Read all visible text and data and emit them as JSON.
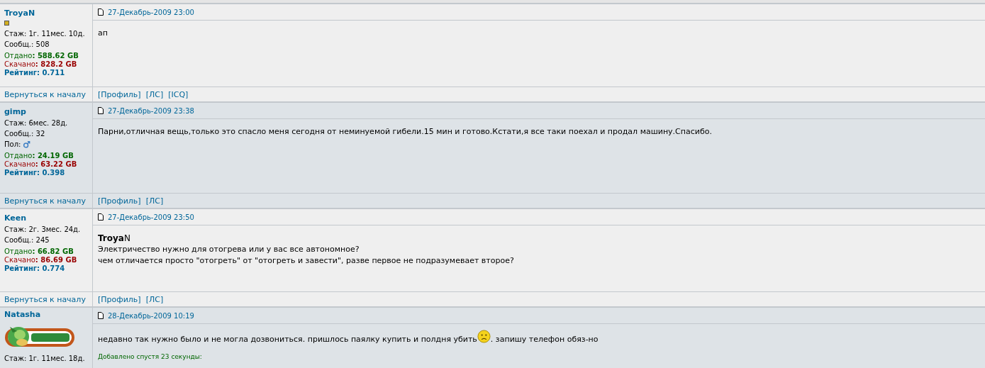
{
  "posts": [
    {
      "author": "**Troya**N",
      "rank_icon": true,
      "stats": [
        {
          "kind": "plain",
          "text": "Стаж: 1г. 11мес. 10д."
        },
        {
          "kind": "plain",
          "text": "Сообщ.: 508"
        },
        {
          "kind": "upload",
          "text": "Отдано**: 588.62 GB**"
        },
        {
          "kind": "download",
          "text": "Скачано**: 828.2 GB**"
        },
        {
          "kind": "rating",
          "text": "Рейтинг: 0.711"
        }
      ],
      "date": "27-Декабрь-2009 23:00",
      "body": [
        {
          "kind": "text",
          "text": "ап"
        }
      ],
      "back_link": "Вернуться к началу",
      "links": [
        "[Профиль]",
        "[ЛС]",
        "[ICQ]"
      ]
    },
    {
      "author": "gimp",
      "stats": [
        {
          "kind": "plain",
          "text": "Стаж: 6мес. 28д."
        },
        {
          "kind": "plain",
          "text": "Сообщ.: 32"
        },
        {
          "kind": "gender",
          "text": "Пол:"
        },
        {
          "kind": "upload",
          "text": "Отдано**: 24.19 GB**"
        },
        {
          "kind": "download",
          "text": "Скачано**: 63.22 GB**"
        },
        {
          "kind": "rating",
          "text": "Рейтинг: 0.398"
        }
      ],
      "date": "27-Декабрь-2009 23:38",
      "body": [
        {
          "kind": "text",
          "text": "Парни,отличная вещь,только это спасло меня сегодня от неминуемой гибели.15 мин и готово.Кстати,я все таки поехал и продал машину.Спасибо."
        }
      ],
      "back_link": "Вернуться к началу",
      "links": [
        "[Профиль]",
        "[ЛС]"
      ]
    },
    {
      "author": "Keen",
      "stats": [
        {
          "kind": "plain",
          "text": "Стаж: 2г. 3мес. 24д."
        },
        {
          "kind": "plain",
          "text": "Сообщ.: 245"
        },
        {
          "kind": "upload",
          "text": "Отдано**: 66.82 GB**"
        },
        {
          "kind": "download",
          "text": "Скачано**: 86.69 GB**"
        },
        {
          "kind": "rating",
          "text": "Рейтинг: 0.774"
        }
      ],
      "date": "27-Декабрь-2009 23:50",
      "body": [
        {
          "kind": "quote_author",
          "text": "**Troya**N"
        },
        {
          "kind": "text",
          "text": "Электричество нужно для отогрева или у вас все автономное?"
        },
        {
          "kind": "text",
          "text": "чем отличается просто \"отогреть\" от \"отогреть и завести\", разве первое не подразумевает второе?"
        }
      ],
      "back_link": "Вернуться к началу",
      "links": [
        "[Профиль]",
        "[ЛС]"
      ]
    },
    {
      "author": "Natasha",
      "avatar": true,
      "stats": [
        {
          "kind": "plain",
          "text": "Стаж: 1г. 11мес. 18д."
        }
      ],
      "date": "28-Декабрь-2009 10:19",
      "body": [
        {
          "kind": "smiley_text",
          "before": "недавно так нужно было и не могла дозвониться. пришлось паялку купить и полдня убить",
          "after": ". запишу телефон обяз-но"
        },
        {
          "kind": "added_note",
          "text": "Добавлено спустя 23 секунды:"
        }
      ]
    }
  ]
}
